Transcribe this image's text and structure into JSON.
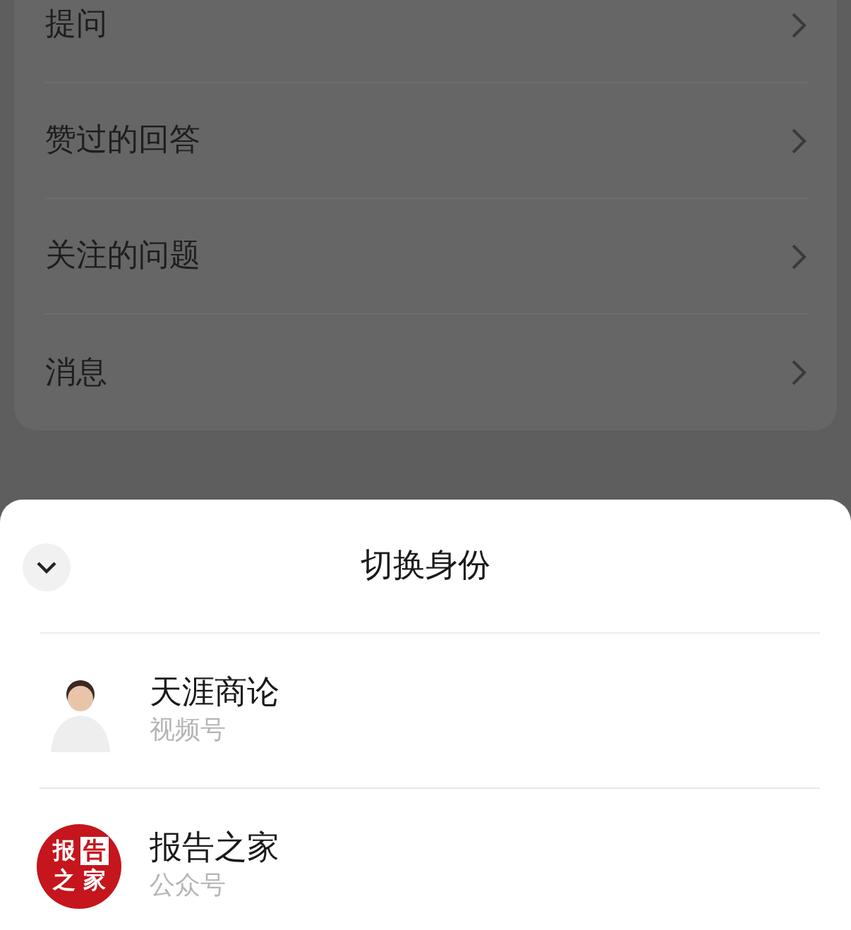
{
  "menu_items": [
    {
      "label": "提问"
    },
    {
      "label": "赞过的回答"
    },
    {
      "label": "关注的问题"
    },
    {
      "label": "消息"
    }
  ],
  "sheet": {
    "title": "切换身份",
    "accounts": [
      {
        "kind": "person",
        "name": "天涯商论",
        "type": "视频号"
      },
      {
        "kind": "logo",
        "name": "报告之家",
        "type": "公众号",
        "logo_text": [
          "报",
          "告",
          "之",
          "家"
        ]
      }
    ]
  }
}
